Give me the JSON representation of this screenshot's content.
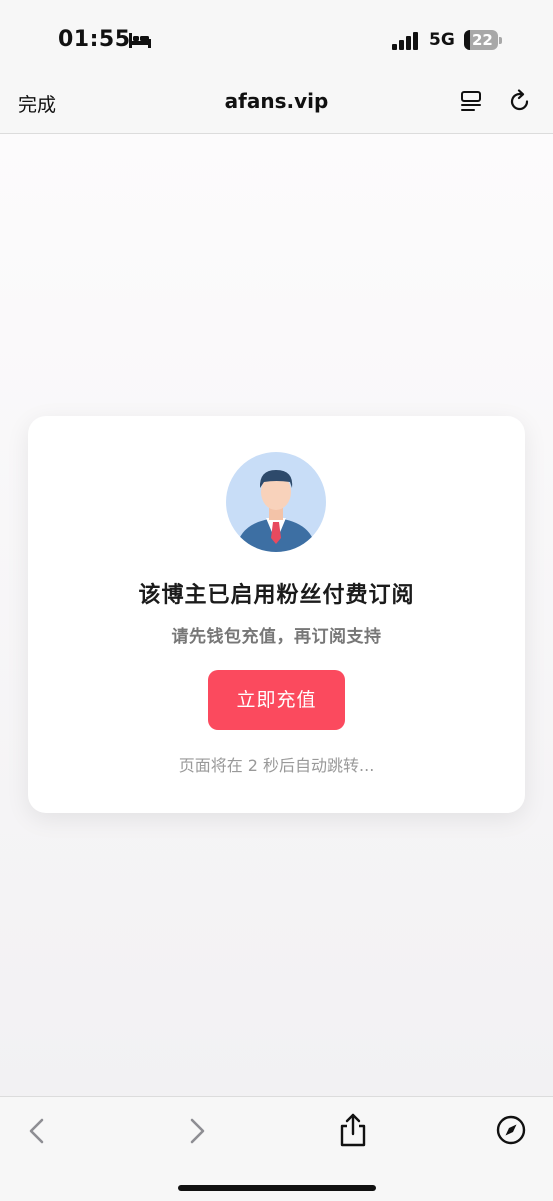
{
  "status": {
    "time": "01:55",
    "network": "5G",
    "battery": "22",
    "icons": [
      "bed-icon",
      "signal-icon"
    ]
  },
  "nav": {
    "done_label": "完成",
    "site_title": "afans.vip",
    "icons": [
      "reader-icon",
      "reload-icon"
    ]
  },
  "card": {
    "title": "该博主已启用粉丝付费订阅",
    "subtitle": "请先钱包充值，再订阅支持",
    "button_label": "立即充值",
    "redirect_text": "页面将在 2 秒后自动跳转...",
    "accent_color": "#fb4a5e"
  },
  "toolbar": {
    "icons": [
      "back-icon",
      "forward-icon",
      "share-icon",
      "compass-icon"
    ]
  }
}
